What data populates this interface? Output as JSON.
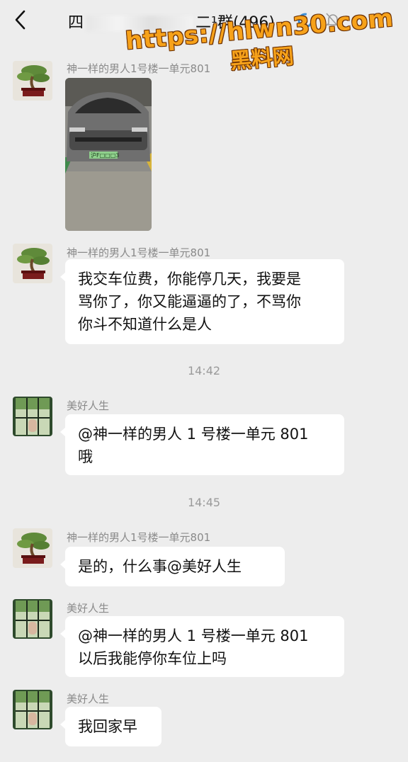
{
  "header": {
    "title_prefix": "四",
    "title_suffix": "二¹群(496)"
  },
  "watermark": {
    "url": "https://hlwn30.com",
    "name": "黑料网"
  },
  "messages": [
    {
      "sender": "神一样的男人1号楼一单元801",
      "type": "image"
    },
    {
      "sender": "神一样的男人1号楼一单元801",
      "lines": [
        "我交车位费，你能停几天，我要是",
        "骂你了，你又能逼逼的了，不骂你",
        "你斗不知道什么是人"
      ]
    },
    {
      "time": "14:42"
    },
    {
      "sender": "美好人生",
      "lines": [
        "@神一样的男人 1 号楼一单元 801",
        "哦"
      ]
    },
    {
      "time": "14:45"
    },
    {
      "sender": "神一样的男人1号楼一单元801",
      "lines": [
        "是的，什么事@美好人生"
      ]
    },
    {
      "sender": "美好人生",
      "lines": [
        "@神一样的男人 1 号楼一单元 801",
        "以后我能停你车位上吗"
      ]
    },
    {
      "sender": "美好人生",
      "lines": [
        "我回家早"
      ]
    }
  ],
  "plate_text": "沪F□□□3",
  "icons": {
    "back": "chevron-left-icon",
    "status": "loading-ring-icon",
    "mute": "bell-muted-icon"
  }
}
